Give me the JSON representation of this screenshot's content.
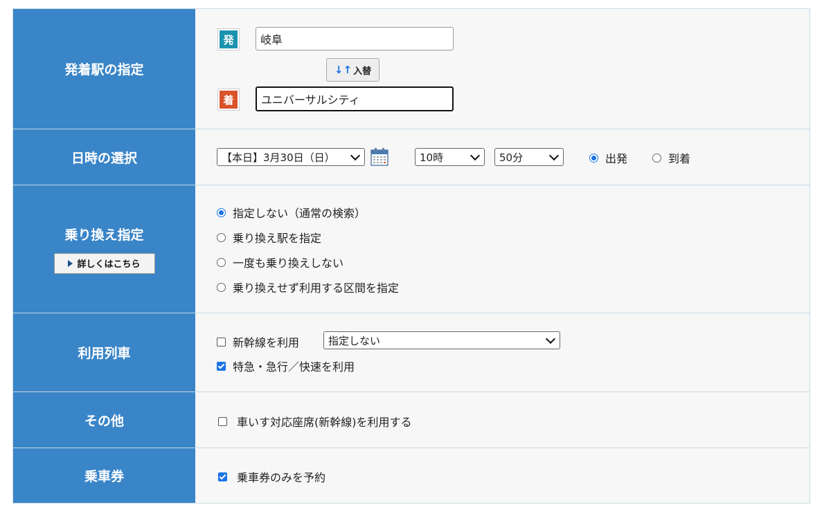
{
  "rows": {
    "station": {
      "header": "発着駅の指定",
      "from_badge": "発",
      "from_value": "岐阜",
      "swap_label": "入替",
      "to_badge": "着",
      "to_value": "ユニバーサルシティ"
    },
    "datetime": {
      "header": "日時の選択",
      "date_value": "【本日】3月30日（日）",
      "hour_value": "10時",
      "minute_value": "50分",
      "depart_label": "出発",
      "arrive_label": "到着"
    },
    "transfer": {
      "header": "乗り換え指定",
      "detail_label": "詳しくはこちら",
      "options": [
        "指定しない（通常の検索）",
        "乗り換え駅を指定",
        "一度も乗り換えしない",
        "乗り換えせず利用する区間を指定"
      ]
    },
    "train": {
      "header": "利用列車",
      "shinkansen_label": "新幹線を利用",
      "shinkansen_select": "指定しない",
      "express_label": "特急・急行／快速を利用"
    },
    "other": {
      "header": "その他",
      "wheelchair_label": "車いす対応座席(新幹線)を利用する"
    },
    "ticket": {
      "header": "乗車券",
      "ticket_only_label": "乗車券のみを予約"
    }
  },
  "colors": {
    "header_bg": "#3a85c8",
    "from_badge": "#1a93ae",
    "to_badge": "#d9532b",
    "accent": "#1a73e8"
  }
}
